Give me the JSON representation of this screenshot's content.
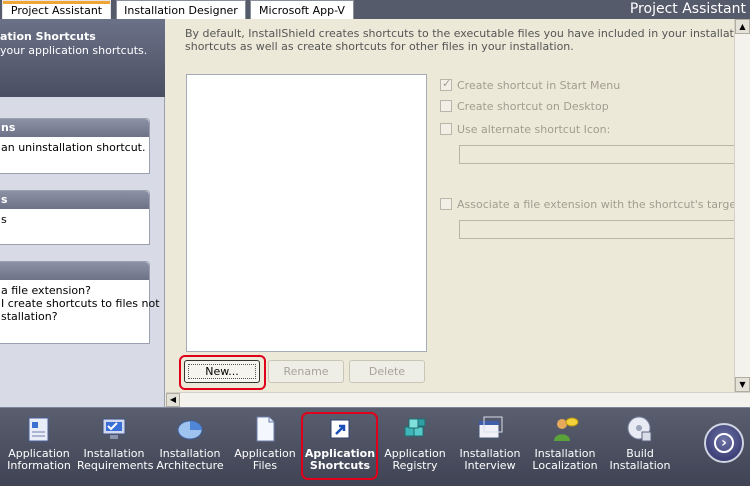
{
  "tabs": [
    "Project Assistant",
    "Installation Designer",
    "Microsoft App-V"
  ],
  "app_title": "Project Assistant",
  "sidebar": {
    "header_title": "ation Shortcuts",
    "header_sub": "your application shortcuts.",
    "panels": [
      {
        "title": "ns",
        "lines": [
          "an uninstallation shortcut."
        ]
      },
      {
        "title": "s",
        "lines": [
          "s"
        ]
      },
      {
        "title": "",
        "lines": [
          "a file extension?",
          "I create shortcuts to files not",
          "stallation?"
        ]
      }
    ]
  },
  "main": {
    "description_lines": [
      "By default, InstallShield creates shortcuts to the executable files you have included in your installation. You can de",
      "shortcuts as well as create shortcuts for other files in your installation."
    ],
    "buttons": {
      "new": "New...",
      "rename": "Rename",
      "delete": "Delete"
    },
    "checkboxes": {
      "start_menu": {
        "label": "Create shortcut in Start Menu",
        "checked": true
      },
      "desktop": {
        "label": "Create shortcut on Desktop",
        "checked": false
      },
      "alt_icon": {
        "label": "Use alternate shortcut Icon:",
        "checked": false
      },
      "file_ext": {
        "label": "Associate a file extension with the shortcut's target:",
        "checked": false
      }
    }
  },
  "bottom_nav": [
    {
      "line1": "Application",
      "line2": "Information",
      "icon": "application-information-icon"
    },
    {
      "line1": "Installation",
      "line2": "Requirements",
      "icon": "installation-requirements-icon"
    },
    {
      "line1": "Installation",
      "line2": "Architecture",
      "icon": "installation-architecture-icon"
    },
    {
      "line1": "Application",
      "line2": "Files",
      "icon": "application-files-icon"
    },
    {
      "line1": "Application",
      "line2": "Shortcuts",
      "icon": "application-shortcuts-icon"
    },
    {
      "line1": "Application",
      "line2": "Registry",
      "icon": "application-registry-icon"
    },
    {
      "line1": "Installation",
      "line2": "Interview",
      "icon": "installation-interview-icon"
    },
    {
      "line1": "Installation",
      "line2": "Localization",
      "icon": "installation-localization-icon"
    },
    {
      "line1": "Build",
      "line2": "Installation",
      "icon": "build-installation-icon"
    }
  ],
  "colors": {
    "highlight": "#e0001b",
    "tab_accent": "#f0a636",
    "toolbar": "#4a4f60"
  }
}
